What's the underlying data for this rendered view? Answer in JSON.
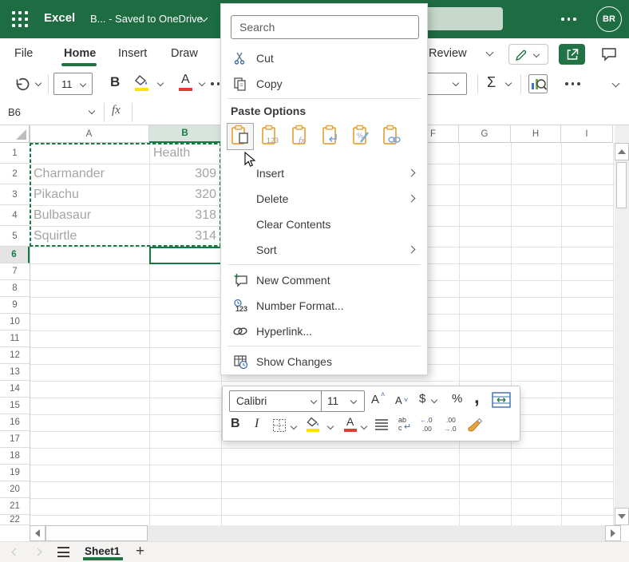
{
  "header": {
    "app_name": "Excel",
    "doc_title": "B... - Saved to OneDrive",
    "avatar_initials": "BR"
  },
  "ribbon": {
    "tabs": [
      "File",
      "Home",
      "Insert",
      "Draw",
      "Review"
    ],
    "active_tab": "Home"
  },
  "toolbar": {
    "font_size": "11",
    "bold_label": "B",
    "font_color_label": "A",
    "autosum_label": "Σ"
  },
  "formula_bar": {
    "name_box_value": "B6",
    "fx_label": "fx",
    "formula_value": ""
  },
  "grid": {
    "visible_columns": [
      "A",
      "B",
      "F",
      "G",
      "H",
      "I"
    ],
    "selected_column": "B",
    "row_labels": [
      "1",
      "2",
      "3",
      "4",
      "5",
      "6",
      "7",
      "8",
      "9",
      "10",
      "11",
      "12",
      "13",
      "14",
      "15",
      "16",
      "17",
      "18",
      "19",
      "20",
      "21",
      "22"
    ],
    "selected_row": "6",
    "cells": [
      {
        "ref": "B1",
        "value": "Health",
        "align": "left"
      },
      {
        "ref": "A2",
        "value": "Charmander",
        "align": "left"
      },
      {
        "ref": "B2",
        "value": "309",
        "align": "right"
      },
      {
        "ref": "A3",
        "value": "Pikachu",
        "align": "left"
      },
      {
        "ref": "B3",
        "value": "320",
        "align": "right"
      },
      {
        "ref": "A4",
        "value": "Bulbasaur",
        "align": "left"
      },
      {
        "ref": "B4",
        "value": "318",
        "align": "right"
      },
      {
        "ref": "A5",
        "value": "Squirtle",
        "align": "left"
      },
      {
        "ref": "B5",
        "value": "314",
        "align": "right"
      }
    ],
    "active_cell": "B6",
    "copy_range": "A1:B5"
  },
  "context_menu": {
    "search_placeholder": "Search",
    "groups": [
      [
        {
          "label": "Cut",
          "icon": "scissors"
        },
        {
          "label": "Copy",
          "icon": "copy"
        }
      ],
      [
        {
          "label": "Insert",
          "submenu": true
        },
        {
          "label": "Delete",
          "submenu": true
        },
        {
          "label": "Clear Contents"
        },
        {
          "label": "Sort",
          "submenu": true
        }
      ],
      [
        {
          "label": "New Comment",
          "icon": "comment-add"
        },
        {
          "label": "Number Format...",
          "icon": "number-format"
        },
        {
          "label": "Hyperlink...",
          "icon": "hyperlink"
        }
      ],
      [
        {
          "label": "Show Changes",
          "icon": "show-changes"
        }
      ]
    ],
    "paste_options_label": "Paste Options",
    "paste_buttons": [
      "paste",
      "paste-values",
      "paste-formulas",
      "paste-transpose",
      "paste-formatting",
      "paste-link"
    ]
  },
  "mini_toolbar": {
    "font_name": "Calibri",
    "font_size": "11",
    "currency_label": "$",
    "percent_label": "%",
    "comma_label": ",",
    "bold_label": "B",
    "italic_label": "I",
    "wrap_top": "ab",
    "wrap_bottom": "c",
    "dec_left_top": "←.0",
    "dec_left_bottom": ".00",
    "dec_right_top": ".00",
    "dec_right_bottom": "→.0"
  },
  "sheet_bar": {
    "sheets": [
      {
        "label": "Sheet1",
        "active": true
      }
    ],
    "add_label": "+"
  },
  "colors": {
    "brand_green": "#1E6C41",
    "accent_green": "#217346",
    "selection_green": "#107C41",
    "fill_yellow": "#FFE100",
    "font_red": "#E03C31",
    "clipboard_orange": "#E8A33D"
  }
}
